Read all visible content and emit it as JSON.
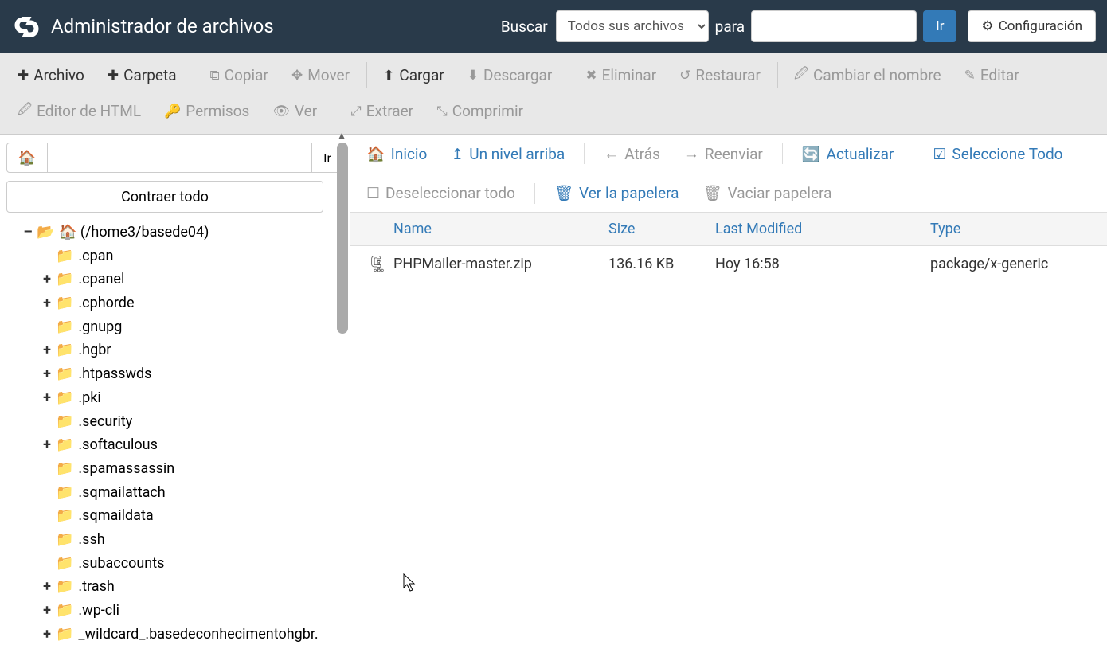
{
  "header": {
    "title": "Administrador de archivos",
    "search_label": "Buscar",
    "search_scope": "Todos sus archivos",
    "for_label": "para",
    "search_value": "",
    "go_label": "Ir",
    "settings_label": "Configuración"
  },
  "toolbar": {
    "file": "Archivo",
    "folder": "Carpeta",
    "copy": "Copiar",
    "move": "Mover",
    "upload": "Cargar",
    "download": "Descargar",
    "delete": "Eliminar",
    "restore": "Restaurar",
    "rename": "Cambiar el nombre",
    "edit": "Editar",
    "html_editor": "Editor de HTML",
    "permissions": "Permisos",
    "view": "Ver",
    "extract": "Extraer",
    "compress": "Comprimir"
  },
  "left": {
    "path_value": "",
    "go_label": "Ir",
    "collapse_label": "Contraer todo",
    "root_label": "(/home3/basede04)",
    "items": [
      {
        "label": ".cpan",
        "expandable": false
      },
      {
        "label": ".cpanel",
        "expandable": true
      },
      {
        "label": ".cphorde",
        "expandable": true
      },
      {
        "label": ".gnupg",
        "expandable": false
      },
      {
        "label": ".hgbr",
        "expandable": true
      },
      {
        "label": ".htpasswds",
        "expandable": true
      },
      {
        "label": ".pki",
        "expandable": true
      },
      {
        "label": ".security",
        "expandable": false
      },
      {
        "label": ".softaculous",
        "expandable": true
      },
      {
        "label": ".spamassassin",
        "expandable": false
      },
      {
        "label": ".sqmailattach",
        "expandable": false
      },
      {
        "label": ".sqmaildata",
        "expandable": false
      },
      {
        "label": ".ssh",
        "expandable": false
      },
      {
        "label": ".subaccounts",
        "expandable": false
      },
      {
        "label": ".trash",
        "expandable": true
      },
      {
        "label": ".wp-cli",
        "expandable": true
      },
      {
        "label": "_wildcard_.basedeconhecimentohgbr.",
        "expandable": true
      }
    ]
  },
  "actions": {
    "home": "Inicio",
    "up": "Un nivel arriba",
    "back": "Atrás",
    "forward": "Reenviar",
    "reload": "Actualizar",
    "select_all": "Seleccione Todo",
    "unselect_all": "Deseleccionar todo",
    "view_trash": "Ver la papelera",
    "empty_trash": "Vaciar papelera"
  },
  "table": {
    "headers": {
      "name": "Name",
      "size": "Size",
      "modified": "Last Modified",
      "type": "Type"
    },
    "rows": [
      {
        "name": "PHPMailer-master.zip",
        "size": "136.16 KB",
        "modified": "Hoy 16:58",
        "type": "package/x-generic"
      }
    ]
  }
}
